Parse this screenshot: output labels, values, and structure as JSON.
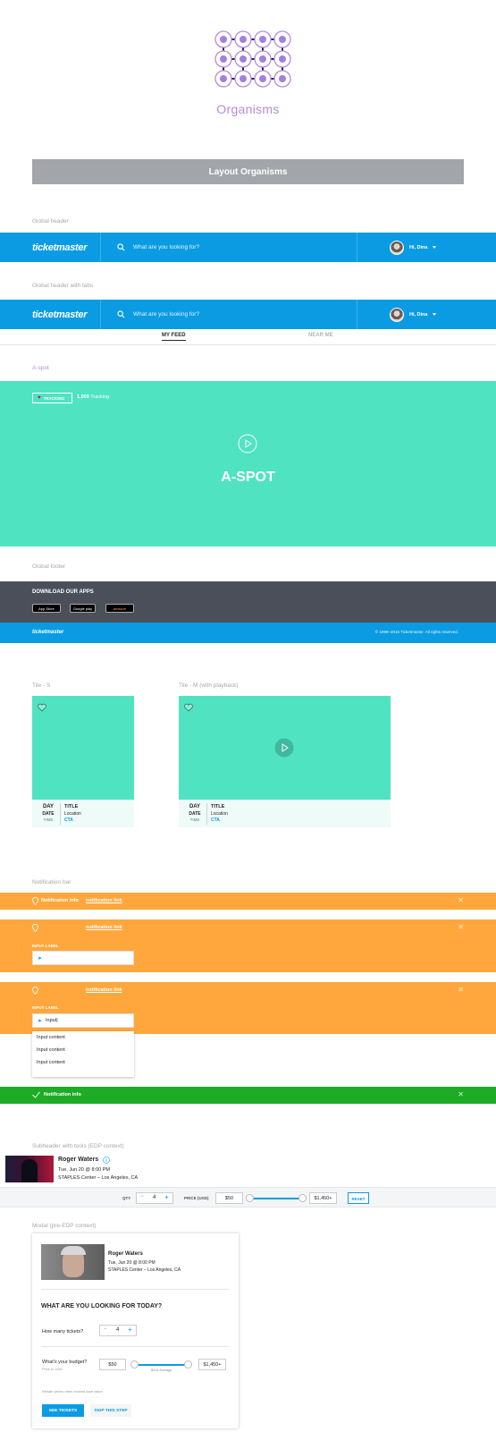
{
  "hero": {
    "title": "Organisms"
  },
  "banner": {
    "title": "Layout Organisms"
  },
  "labels": {
    "global_header": "Global header",
    "global_header_tabs": "Global header with tabs",
    "a_spot": "A-spot",
    "global_footer": "Global footer",
    "tile_s": "Tile - S",
    "tile_m": "Tile - M (with playback)",
    "notification_bar": "Notification bar",
    "subheader": "Subheader with tools (EDP context)",
    "modal": "Modal (pre-EDP context)"
  },
  "header": {
    "logo": "ticketmaster",
    "search_placeholder": "What are you looking for?",
    "user_greeting": "Hi, Dina"
  },
  "tabs": [
    "MY FEED",
    "NEAR ME"
  ],
  "aspot": {
    "tracking_button": "TRACKING",
    "tracking_count": "1,000",
    "tracking_text": "Tracking",
    "title": "A-SPOT"
  },
  "footer": {
    "download_title": "DOWNLOAD OUR APPS",
    "stores": [
      "App Store",
      "Google play",
      "amazon"
    ],
    "logo": "ticketmaster",
    "copyright": "© 1999–2016 Ticketmaster. All rights reserved."
  },
  "tile": {
    "day": "DAY",
    "date": "DATE",
    "time": "TIME",
    "title": "TITLE",
    "location": "Location",
    "cta": "CTA"
  },
  "notifications": {
    "info": "Notification info",
    "link": "notification link",
    "input_label": "INPUT LABEL",
    "input_value": "Input|",
    "dropdown_items": [
      "Input content",
      "Input content",
      "Input content"
    ],
    "success": "Notification info"
  },
  "event": {
    "name": "Roger Waters",
    "date": "Tue, Jun 20 @ 8:00 PM",
    "venue": "STAPLES Center – Los Angeles, CA"
  },
  "tools": {
    "qty_label": "QTY",
    "qty_value": "4",
    "price_label": "PRICE (USD)",
    "price_min": "$50",
    "price_max": "$1,450+",
    "reset": "RESET"
  },
  "modal": {
    "question": "WHAT ARE YOU LOOKING FOR TODAY?",
    "how_many": "How many tickets?",
    "qty_value": "4",
    "budget": "What's your budget?",
    "budget_sub": "Price in USD",
    "price_min": "$50",
    "price_max": "$1,450+",
    "average": "$314 Average",
    "resale_note": "Resale prices often exceed face value.",
    "see_tickets": "SEE TICKETS",
    "skip": "SKIP THIS STEP"
  },
  "colors": {
    "brand_blue": "#0b9be3",
    "teal": "#50e3c2",
    "orange": "#ffa73d",
    "green": "#1eab25",
    "footer_dark": "#4a4f5a",
    "purple": "#b28cd8"
  }
}
